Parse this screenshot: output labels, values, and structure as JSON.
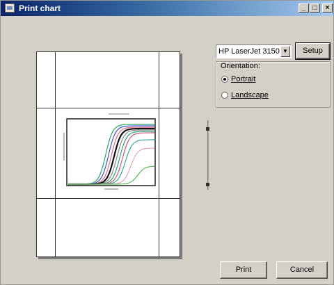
{
  "window": {
    "title": "Print chart",
    "controls": {
      "minimize": "_",
      "maximize": "□",
      "close": "×"
    }
  },
  "printer": {
    "selected": "HP LaserJet 3150",
    "setup_label": "Setup"
  },
  "orientation": {
    "group_label": "Orientation",
    "options": [
      {
        "label": "Portrait",
        "selected": true
      },
      {
        "label": "Landscape",
        "selected": false
      }
    ]
  },
  "buttons": {
    "print": "Print",
    "cancel": "Cancel"
  },
  "colors": {
    "title_start": "#0a246a",
    "title_end": "#a6caf0",
    "dialog_bg": "#d4d0c8"
  },
  "preview_curves": [
    "#2aa36b",
    "#3a56c8",
    "#e06b8b",
    "#111111",
    "#8a8a8a",
    "#2aa36b",
    "#c8547a",
    "#3aa39a",
    "#e0a6b4",
    "#5cb85c"
  ]
}
